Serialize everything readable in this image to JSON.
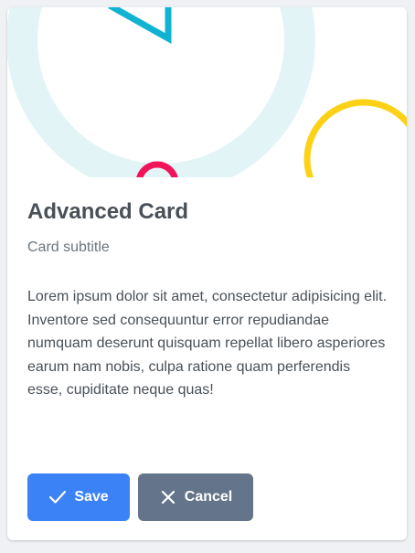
{
  "card": {
    "title": "Advanced Card",
    "subtitle": "Card subtitle",
    "content": "Lorem ipsum dolor sit amet, consectetur adipisicing elit. Inventore sed consequuntur error repudiandae numquam deserunt quisquam repellat libero asperiores earum nam nobis, culpa ratione quam perferendis esse, cupiditate neque quas!",
    "save_label": "Save",
    "cancel_label": "Cancel",
    "save_icon": "check-icon",
    "cancel_icon": "close-icon"
  },
  "colors": {
    "save_button": "#3b82f6",
    "cancel_button": "#64748b",
    "ring_light": "#e3f4f7",
    "triangle": "#10b3d1",
    "ring_yellow": "#fcd116",
    "ring_pink": "#f0145a"
  }
}
